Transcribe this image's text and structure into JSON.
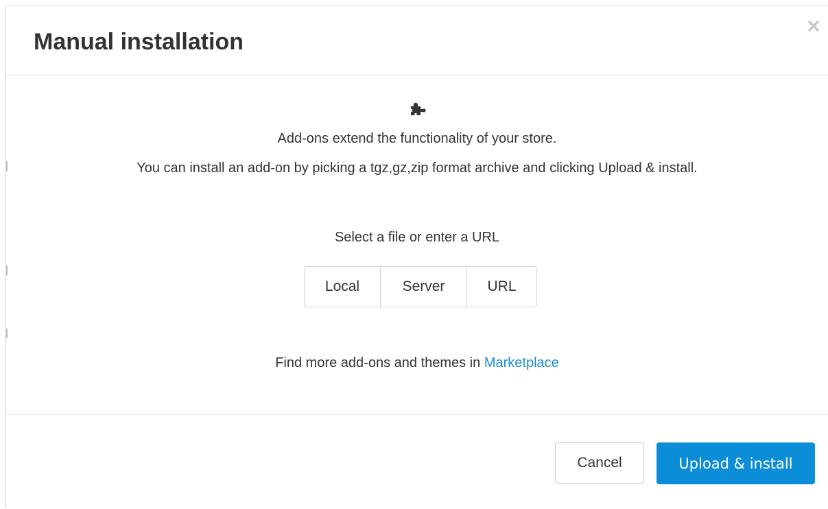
{
  "dialog": {
    "title": "Manual installation",
    "close_icon": "close-icon"
  },
  "body": {
    "icon": "puzzle-piece-icon",
    "description_line1": "Add-ons extend the functionality of your store.",
    "description_line2": "You can install an add-on by picking a tgz,gz,zip format archive and clicking Upload & install.",
    "select_label": "Select a file or enter a URL",
    "source_options": [
      "Local",
      "Server",
      "URL"
    ],
    "marketplace_prefix": "Find more add-ons and themes in ",
    "marketplace_link": "Marketplace"
  },
  "footer": {
    "cancel_label": "Cancel",
    "upload_label": "Upload & install"
  },
  "colors": {
    "primary": "#0b8dd8",
    "link": "#1a8bd6",
    "text": "#333333"
  }
}
